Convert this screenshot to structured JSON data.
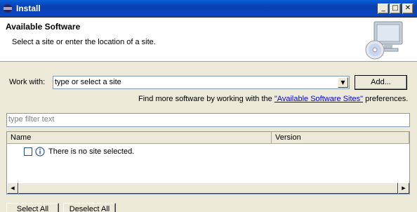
{
  "window": {
    "title": "Install"
  },
  "header": {
    "title": "Available Software",
    "description": "Select a site or enter the location of a site."
  },
  "work_with": {
    "label": "Work with:",
    "value": "type or select a site",
    "add_label": "Add..."
  },
  "find_more": {
    "prefix": "Find more software by working with the ",
    "link": "\"Available Software Sites\"",
    "suffix": " preferences."
  },
  "filter": {
    "placeholder": "type filter text"
  },
  "table": {
    "columns": [
      "Name",
      "Version"
    ],
    "rows": [
      {
        "name": "There is no site selected."
      }
    ]
  },
  "buttons": {
    "select_all": "Select All",
    "deselect_all": "Deselect All"
  }
}
